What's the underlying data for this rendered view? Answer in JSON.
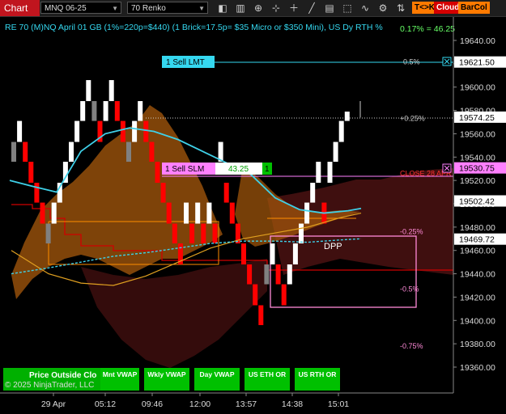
{
  "toolbar": {
    "chart_label": "Chart",
    "instrument": "MNQ 06-25",
    "bar_type": "70 Renko",
    "tag_tk": "T<>K",
    "tag_cloud": "Cloud",
    "tag_barcol": "BarCol",
    "icons": [
      "pointer-icon",
      "bar-type-icon",
      "magnifier-icon",
      "crosshair-icon",
      "plus-icon",
      "line-tool-icon",
      "text-tool-icon",
      "shape-tool-icon",
      "indicator-icon",
      "strategy-icon",
      "trade-icon",
      "signal-icon",
      "lock-icon"
    ]
  },
  "header": {
    "info": "RE 70 (M)NQ April 01 GB (1%=220p=$440) (1 Brick=17.5p= $35 Micro or $350 Mini), US Dy RTH %",
    "top_right": "0.17% = 46.25"
  },
  "price_axis": {
    "ticks": [
      "19640.00",
      "19620.00",
      "19600.00",
      "19580.00",
      "19560.00",
      "19540.00",
      "19520.00",
      "19500.00",
      "19480.00",
      "19460.00",
      "19440.00",
      "19420.00",
      "19400.00",
      "19380.00",
      "19360.00"
    ],
    "tags": [
      {
        "label": "19621.50",
        "bg": "#ffffff",
        "fg": "#000000"
      },
      {
        "label": "19574.25",
        "bg": "#ffffff",
        "fg": "#000000"
      },
      {
        "label": "19530.75",
        "bg": "#ff80ff",
        "fg": "#000000"
      },
      {
        "label": "19502.42",
        "bg": "#ffffff",
        "fg": "#000000"
      },
      {
        "label": "19469.72",
        "bg": "#ffffff",
        "fg": "#000000"
      }
    ]
  },
  "time_axis": [
    "29 Apr",
    "05:12",
    "09:46",
    "12:00",
    "13:57",
    "14:38",
    "15:01"
  ],
  "orders": {
    "sell_lmt": {
      "label": "1 Sell LMT",
      "price": 19621.5
    },
    "sell_slm": {
      "label": "1 Sell SLM",
      "value": "43.25",
      "qty": "1",
      "price": 19530.75
    }
  },
  "levels": [
    {
      "label": "0.5%",
      "price": 19621.5
    },
    {
      "label": "+0.25%",
      "price": 19573
    },
    {
      "label": "CLOSE 28 APR",
      "price": 19526
    },
    {
      "label": "-0.25%",
      "price": 19476
    },
    {
      "label": "-0.5%",
      "price": 19427
    },
    {
      "label": "-0.75%",
      "price": 19378
    }
  ],
  "dpp_label": "DPP",
  "bottom_panel": {
    "left_title": "Price Outside Clo",
    "copyright": "© 2025 NinjaTrader, LLC",
    "buttons": [
      "Mnt VWAP",
      "Wkly VWAP",
      "Day VWAP",
      "US ETH OR",
      "US RTH OR"
    ]
  },
  "colors": {
    "bull": "#ffffff",
    "bear": "#ff0000",
    "neutral": "#808080",
    "cyan_line": "#3fd0e8",
    "cloud_orange": "#b8620e",
    "cloud_dark": "#5a1a1a",
    "level_pink": "#ff8ad8",
    "panel_green": "#00c000"
  },
  "chart_data": {
    "type": "renko",
    "ylim": [
      19350,
      19650
    ],
    "brick_size": 17.5,
    "bricks": [
      [
        "u",
        19536,
        19553
      ],
      [
        "u",
        19553,
        19571
      ],
      [
        "d",
        19553,
        19536
      ],
      [
        "d",
        19536,
        19518
      ],
      [
        "d",
        19518,
        19501
      ],
      [
        "d",
        19501,
        19483
      ],
      [
        "d",
        19483,
        19466
      ],
      [
        "u",
        19483,
        19501
      ],
      [
        "u",
        19501,
        19518
      ],
      [
        "u",
        19518,
        19536
      ],
      [
        "u",
        19536,
        19553
      ],
      [
        "u",
        19553,
        19571
      ],
      [
        "u",
        19571,
        19588
      ],
      [
        "u",
        19588,
        19606
      ],
      [
        "d",
        19588,
        19571
      ],
      [
        "d",
        19571,
        19553
      ],
      [
        "u",
        19571,
        19588
      ],
      [
        "u",
        19588,
        19606
      ],
      [
        "d",
        19588,
        19571
      ],
      [
        "d",
        19571,
        19553
      ],
      [
        "d",
        19553,
        19536
      ],
      [
        "u",
        19553,
        19571
      ],
      [
        "u",
        19571,
        19588
      ],
      [
        "d",
        19571,
        19553
      ],
      [
        "d",
        19553,
        19536
      ],
      [
        "d",
        19536,
        19518
      ],
      [
        "d",
        19518,
        19501
      ],
      [
        "d",
        19501,
        19483
      ],
      [
        "d",
        19483,
        19466
      ],
      [
        "d",
        19466,
        19448
      ],
      [
        "u",
        19483,
        19501
      ],
      [
        "d",
        19483,
        19466
      ],
      [
        "u",
        19483,
        19501
      ],
      [
        "d",
        19483,
        19466
      ],
      [
        "u",
        19483,
        19501
      ],
      [
        "d",
        19483,
        19466
      ],
      [
        "u",
        19536,
        19553
      ],
      [
        "d",
        19518,
        19501
      ],
      [
        "d",
        19501,
        19483
      ],
      [
        "d",
        19483,
        19466
      ],
      [
        "d",
        19466,
        19448
      ],
      [
        "d",
        19448,
        19431
      ],
      [
        "d",
        19431,
        19413
      ],
      [
        "d",
        19413,
        19396
      ],
      [
        "u",
        19431,
        19448
      ],
      [
        "u",
        19448,
        19466
      ],
      [
        "d",
        19448,
        19431
      ],
      [
        "d",
        19431,
        19413
      ],
      [
        "u",
        19431,
        19448
      ],
      [
        "u",
        19448,
        19466
      ],
      [
        "u",
        19466,
        19483
      ],
      [
        "u",
        19483,
        19501
      ],
      [
        "u",
        19501,
        19518
      ],
      [
        "u",
        19518,
        19536
      ],
      [
        "d",
        19501,
        19483
      ],
      [
        "u",
        19518,
        19536
      ],
      [
        "u",
        19536,
        19553
      ],
      [
        "u",
        19553,
        19571
      ],
      [
        "u",
        19571,
        19579
      ]
    ],
    "lines": {
      "cyan_upper": [
        [
          12,
          19520
        ],
        [
          40,
          19515
        ],
        [
          70,
          19510
        ],
        [
          100,
          19545
        ],
        [
          130,
          19560
        ],
        [
          160,
          19565
        ],
        [
          190,
          19562
        ],
        [
          220,
          19555
        ],
        [
          250,
          19545
        ],
        [
          280,
          19535
        ],
        [
          310,
          19525
        ],
        [
          340,
          19505
        ],
        [
          370,
          19495
        ],
        [
          400,
          19492
        ],
        [
          430,
          19494
        ],
        [
          446,
          19496
        ]
      ],
      "cyan_lower": [
        [
          14,
          19440
        ],
        [
          60,
          19445
        ],
        [
          100,
          19450
        ],
        [
          140,
          19455
        ],
        [
          180,
          19458
        ],
        [
          220,
          19462
        ],
        [
          260,
          19466
        ],
        [
          300,
          19468
        ],
        [
          340,
          19468
        ],
        [
          380,
          19467
        ],
        [
          420,
          19469
        ],
        [
          446,
          19470
        ]
      ],
      "gold": [
        [
          14,
          19460
        ],
        [
          60,
          19440
        ],
        [
          100,
          19432
        ],
        [
          140,
          19430
        ],
        [
          180,
          19438
        ],
        [
          220,
          19450
        ],
        [
          260,
          19462
        ],
        [
          300,
          19470
        ],
        [
          340,
          19475
        ],
        [
          380,
          19480
        ],
        [
          420,
          19488
        ],
        [
          446,
          19492
        ]
      ]
    }
  }
}
